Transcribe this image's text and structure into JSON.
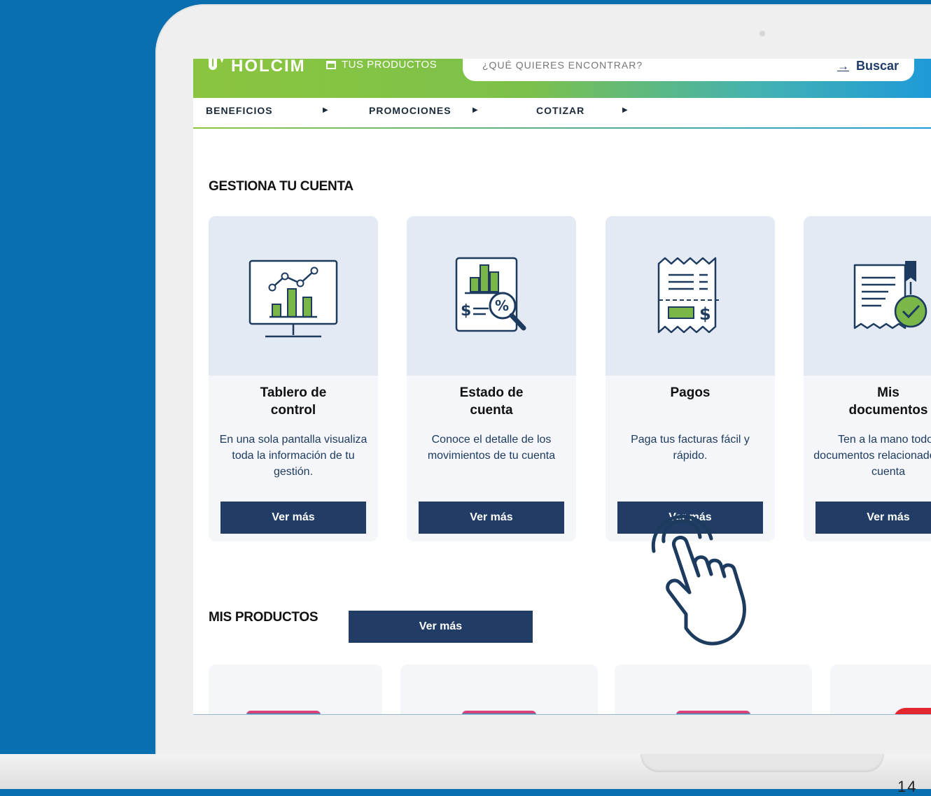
{
  "header": {
    "logo_text": "HOLCIM",
    "products_link": "TUS PRODUCTOS",
    "search_placeholder": "¿QUÉ QUIERES ENCONTRAR?",
    "search_arrow": "→",
    "search_button": "Buscar"
  },
  "nav": {
    "items": [
      {
        "label": "BENEFICIOS"
      },
      {
        "label": "PROMOCIONES"
      },
      {
        "label": "COTIZAR"
      }
    ],
    "caret": "▶"
  },
  "account_section": {
    "title": "GESTIONA TU CUENTA",
    "cards": [
      {
        "title_line1": "Tablero de",
        "title_line2": "control",
        "desc": "En una sola pantalla visualiza toda la información de tu gestión.",
        "button": "Ver más",
        "icon": "dashboard-chart-icon"
      },
      {
        "title_line1": "Estado de",
        "title_line2": "cuenta",
        "desc": "Conoce el detalle de los movimientos de tu cuenta",
        "button": "Ver más",
        "icon": "account-statement-icon"
      },
      {
        "title_line1": "",
        "title_line2": "Pagos",
        "desc": "Paga tus facturas fácil y rápido.",
        "button": "Ver más",
        "icon": "receipt-payment-icon"
      },
      {
        "title_line1": "Mis",
        "title_line2": "documentos",
        "desc": "Ten a la mano todos documentos relacionados a tu cuenta",
        "button": "Ver más",
        "icon": "documents-check-icon"
      }
    ]
  },
  "products_section": {
    "title": "MIS PRODUCTOS",
    "button": "Ver más"
  },
  "footer": {
    "page_number": "14"
  },
  "colors": {
    "background": "#0a6fb0",
    "navy": "#213d66",
    "green": "#8bc53f",
    "blue": "#1f9ad8"
  }
}
